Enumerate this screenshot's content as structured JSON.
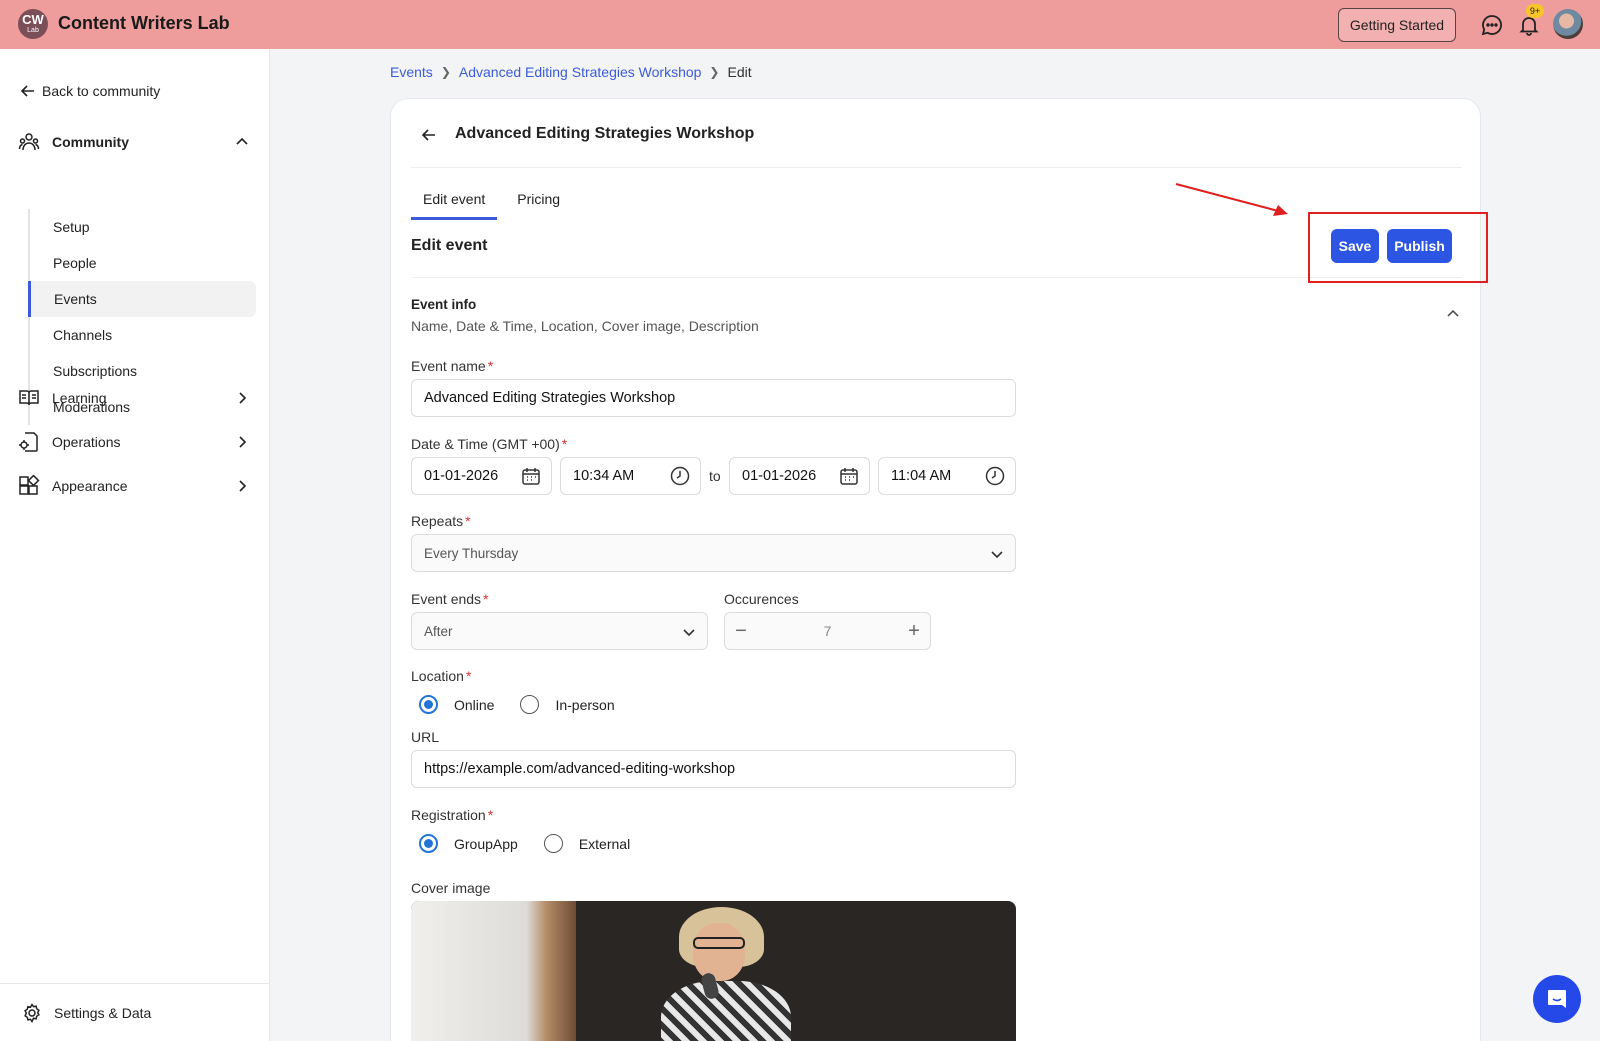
{
  "app": {
    "logo_text": "CW",
    "logo_sub": "Lab",
    "title": "Content Writers Lab",
    "getting_started": "Getting Started",
    "notification_count": "9+"
  },
  "sidebar": {
    "back_link": "Back to community",
    "community": "Community",
    "sub_items": [
      "Setup",
      "People",
      "Events",
      "Channels",
      "Subscriptions",
      "Moderations"
    ],
    "active_sub": "Events",
    "learning": "Learning",
    "operations": "Operations",
    "appearance": "Appearance",
    "settings": "Settings & Data"
  },
  "breadcrumb": {
    "events": "Events",
    "workshop": "Advanced Editing Strategies Workshop",
    "current": "Edit"
  },
  "card": {
    "title": "Advanced Editing Strategies Workshop",
    "tabs": [
      "Edit event",
      "Pricing"
    ],
    "section_title": "Edit event",
    "save": "Save",
    "publish": "Publish",
    "info_title": "Event info",
    "info_sub": "Name, Date & Time, Location, Cover image, Description"
  },
  "form": {
    "event_name_label": "Event name",
    "event_name_value": "Advanced Editing Strategies Workshop",
    "datetime_label": "Date & Time (GMT +00)",
    "start_date": "01-01-2026",
    "start_time": "10:34 AM",
    "to": "to",
    "end_date": "01-01-2026",
    "end_time": "11:04 AM",
    "repeats_label": "Repeats",
    "repeats_value": "Every Thursday",
    "event_ends_label": "Event ends",
    "event_ends_value": "After",
    "occurences_label": "Occurences",
    "occurences_value": "7",
    "location_label": "Location",
    "location_online": "Online",
    "location_inperson": "In-person",
    "url_label": "URL",
    "url_value": "https://example.com/advanced-editing-workshop",
    "registration_label": "Registration",
    "registration_groupapp": "GroupApp",
    "registration_external": "External",
    "cover_label": "Cover image",
    "required_mark": "*"
  },
  "colors": {
    "topbar": "#ee9c9c",
    "accent": "#2d55e4",
    "annotation": "#e02020"
  }
}
